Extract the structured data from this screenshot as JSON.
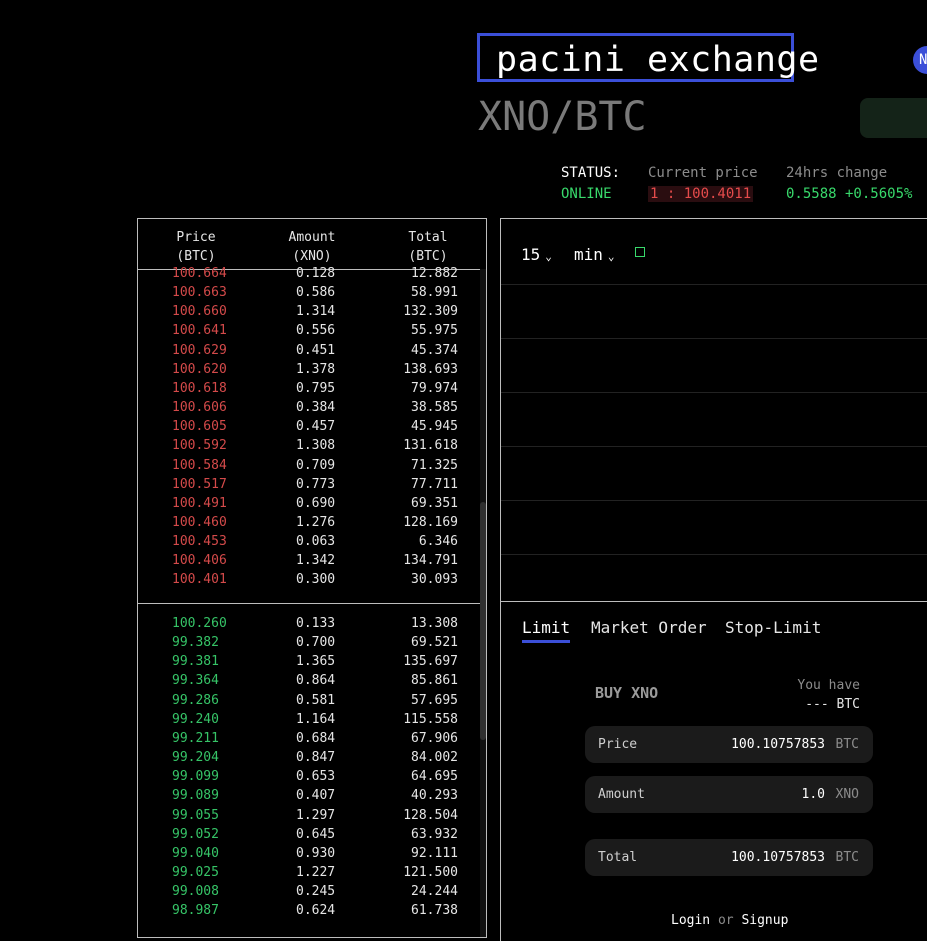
{
  "header": {
    "brand": "pacini exchange",
    "avatar_initial": "N",
    "pair": "XNO/BTC"
  },
  "status": {
    "label": "STATUS:",
    "value": "ONLINE",
    "current_price_label": "Current price",
    "current_price_value": "1 : 100.4011",
    "change_label": "24hrs change",
    "change_value": "0.5588 +0.5605%"
  },
  "orderbook": {
    "headers": [
      {
        "line1": "Price",
        "line2": "(BTC)"
      },
      {
        "line1": "Amount",
        "line2": "(XNO)"
      },
      {
        "line1": "Total",
        "line2": "(BTC)"
      }
    ],
    "asks": [
      {
        "price": "100.664",
        "amount": "0.128",
        "total": "12.882"
      },
      {
        "price": "100.663",
        "amount": "0.586",
        "total": "58.991"
      },
      {
        "price": "100.660",
        "amount": "1.314",
        "total": "132.309"
      },
      {
        "price": "100.641",
        "amount": "0.556",
        "total": "55.975"
      },
      {
        "price": "100.629",
        "amount": "0.451",
        "total": "45.374"
      },
      {
        "price": "100.620",
        "amount": "1.378",
        "total": "138.693"
      },
      {
        "price": "100.618",
        "amount": "0.795",
        "total": "79.974"
      },
      {
        "price": "100.606",
        "amount": "0.384",
        "total": "38.585"
      },
      {
        "price": "100.605",
        "amount": "0.457",
        "total": "45.945"
      },
      {
        "price": "100.592",
        "amount": "1.308",
        "total": "131.618"
      },
      {
        "price": "100.584",
        "amount": "0.709",
        "total": "71.325"
      },
      {
        "price": "100.517",
        "amount": "0.773",
        "total": "77.711"
      },
      {
        "price": "100.491",
        "amount": "0.690",
        "total": "69.351"
      },
      {
        "price": "100.460",
        "amount": "1.276",
        "total": "128.169"
      },
      {
        "price": "100.453",
        "amount": "0.063",
        "total": "6.346"
      },
      {
        "price": "100.406",
        "amount": "1.342",
        "total": "134.791"
      },
      {
        "price": "100.401",
        "amount": "0.300",
        "total": "30.093"
      }
    ],
    "bids": [
      {
        "price": "100.260",
        "amount": "0.133",
        "total": "13.308"
      },
      {
        "price": "99.382",
        "amount": "0.700",
        "total": "69.521"
      },
      {
        "price": "99.381",
        "amount": "1.365",
        "total": "135.697"
      },
      {
        "price": "99.364",
        "amount": "0.864",
        "total": "85.861"
      },
      {
        "price": "99.286",
        "amount": "0.581",
        "total": "57.695"
      },
      {
        "price": "99.240",
        "amount": "1.164",
        "total": "115.558"
      },
      {
        "price": "99.211",
        "amount": "0.684",
        "total": "67.906"
      },
      {
        "price": "99.204",
        "amount": "0.847",
        "total": "84.002"
      },
      {
        "price": "99.099",
        "amount": "0.653",
        "total": "64.695"
      },
      {
        "price": "99.089",
        "amount": "0.407",
        "total": "40.293"
      },
      {
        "price": "99.055",
        "amount": "1.297",
        "total": "128.504"
      },
      {
        "price": "99.052",
        "amount": "0.645",
        "total": "63.932"
      },
      {
        "price": "99.040",
        "amount": "0.930",
        "total": "92.111"
      },
      {
        "price": "99.025",
        "amount": "1.227",
        "total": "121.500"
      },
      {
        "price": "99.008",
        "amount": "0.245",
        "total": "24.244"
      },
      {
        "price": "98.987",
        "amount": "0.624",
        "total": "61.738"
      }
    ]
  },
  "chart": {
    "interval_value": "15",
    "interval_unit": "min",
    "chevron": "⌄",
    "toggle_icon": "square-icon"
  },
  "order_form": {
    "tabs": [
      "Limit",
      "Market Order",
      "Stop-Limit"
    ],
    "active_tab": "Limit",
    "title": "BUY XNO",
    "you_have_label": "You have",
    "you_have_value": "--- BTC",
    "price_label": "Price",
    "price_value": "100.10757853",
    "price_unit": "BTC",
    "amount_label": "Amount",
    "amount_value": "1.0",
    "amount_unit": "XNO",
    "total_label": "Total",
    "total_value": "100.10757853",
    "total_unit": "BTC",
    "login": "Login",
    "or": "or",
    "signup": "Signup"
  },
  "colors": {
    "accent": "#3b4fd8",
    "ask": "#d44a4a",
    "bid": "#36c467",
    "online": "#38d96b"
  }
}
